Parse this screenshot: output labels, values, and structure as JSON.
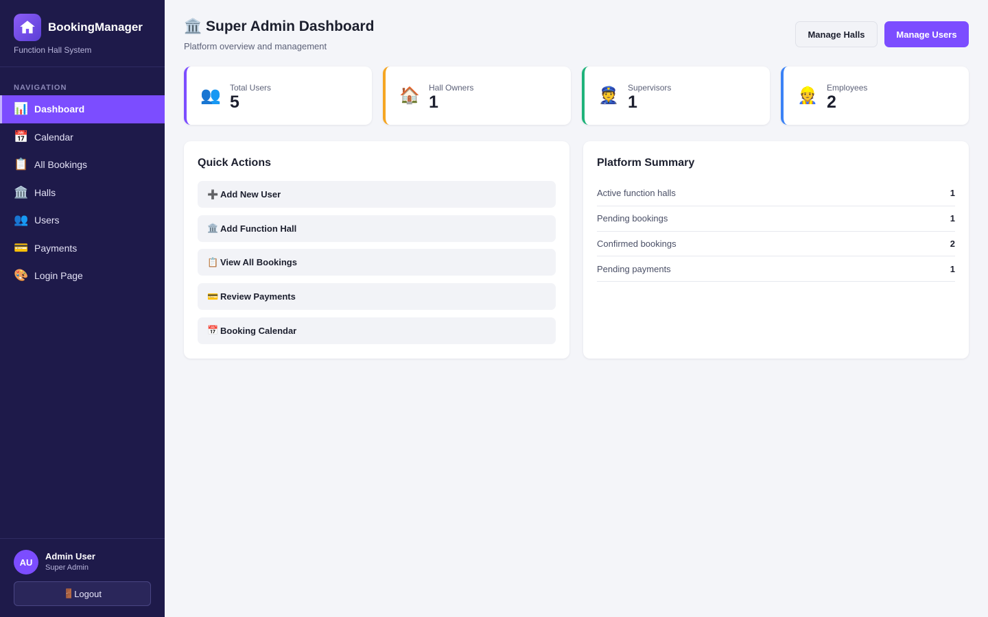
{
  "brand": {
    "name": "BookingManager",
    "subtitle": "Function Hall System",
    "logo_icon": "house-icon"
  },
  "nav": {
    "section_label": "NAVIGATION",
    "items": [
      {
        "icon": "📊",
        "label": "Dashboard",
        "active": true
      },
      {
        "icon": "📅",
        "label": "Calendar"
      },
      {
        "icon": "📋",
        "label": "All Bookings"
      },
      {
        "icon": "🏛️",
        "label": "Halls"
      },
      {
        "icon": "👥",
        "label": "Users"
      },
      {
        "icon": "💳",
        "label": "Payments"
      },
      {
        "icon": "🎨",
        "label": "Login Page"
      }
    ]
  },
  "user": {
    "initials": "AU",
    "name": "Admin User",
    "role": "Super Admin",
    "logout_icon": "🚪",
    "logout_label": "Logout"
  },
  "header": {
    "title_icon": "🏛️",
    "title": "Super Admin Dashboard",
    "subtitle": "Platform overview and management",
    "manage_halls_label": "Manage Halls",
    "manage_users_label": "Manage Users"
  },
  "stats": [
    {
      "icon": "👥",
      "label": "Total Users",
      "value": "5",
      "accent": "#7c4dff"
    },
    {
      "icon": "🏠",
      "label": "Hall Owners",
      "value": "1",
      "accent": "#f5a623"
    },
    {
      "icon": "👮",
      "label": "Supervisors",
      "value": "1",
      "accent": "#1fb37a"
    },
    {
      "icon": "👷",
      "label": "Employees",
      "value": "2",
      "accent": "#3b82f6"
    }
  ],
  "quick_actions": {
    "title": "Quick Actions",
    "items": [
      {
        "icon": "➕",
        "label": "Add New User"
      },
      {
        "icon": "🏛️",
        "label": "Add Function Hall"
      },
      {
        "icon": "📋",
        "label": "View All Bookings"
      },
      {
        "icon": "💳",
        "label": "Review Payments"
      },
      {
        "icon": "📅",
        "label": "Booking Calendar"
      }
    ]
  },
  "summary": {
    "title": "Platform Summary",
    "rows": [
      {
        "label": "Active function halls",
        "value": "1"
      },
      {
        "label": "Pending bookings",
        "value": "1"
      },
      {
        "label": "Confirmed bookings",
        "value": "2"
      },
      {
        "label": "Pending payments",
        "value": "1"
      }
    ]
  },
  "colors": {
    "sidebar_bg": "#1e1a4a",
    "primary": "#7c4dff",
    "page_bg": "#f4f5f9"
  }
}
